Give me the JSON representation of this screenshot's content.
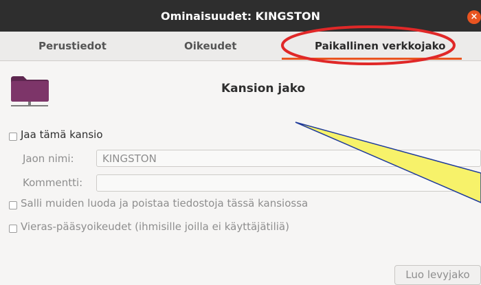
{
  "window": {
    "title": "Ominaisuudet: KINGSTON",
    "close_glyph": "×"
  },
  "tabs": [
    {
      "label": "Perustiedot",
      "active": false
    },
    {
      "label": "Oikeudet",
      "active": false
    },
    {
      "label": "Paikallinen verkkojako",
      "active": true
    }
  ],
  "section": {
    "title": "Kansion jako",
    "icon": "folder-network-icon"
  },
  "share": {
    "share_checkbox_label": "Jaa tämä kansio",
    "share_checked": false,
    "name_label": "Jaon nimi:",
    "name_value": "KINGSTON",
    "comment_label": "Kommentti:",
    "comment_value": "",
    "allow_modify_label": "Salli muiden luoda ja poistaa tiedostoja tässä kansiossa",
    "guest_access_label": "Vieras-pääsyoikeudet (ihmisille joilla ei käyttäjätiliä)"
  },
  "actions": {
    "create_share_label": "Luo levyjako"
  },
  "colors": {
    "titlebar": "#2e2e2e",
    "accent": "#e95420",
    "annotation_red": "#e02828",
    "annotation_fill": "#f7f26a"
  }
}
